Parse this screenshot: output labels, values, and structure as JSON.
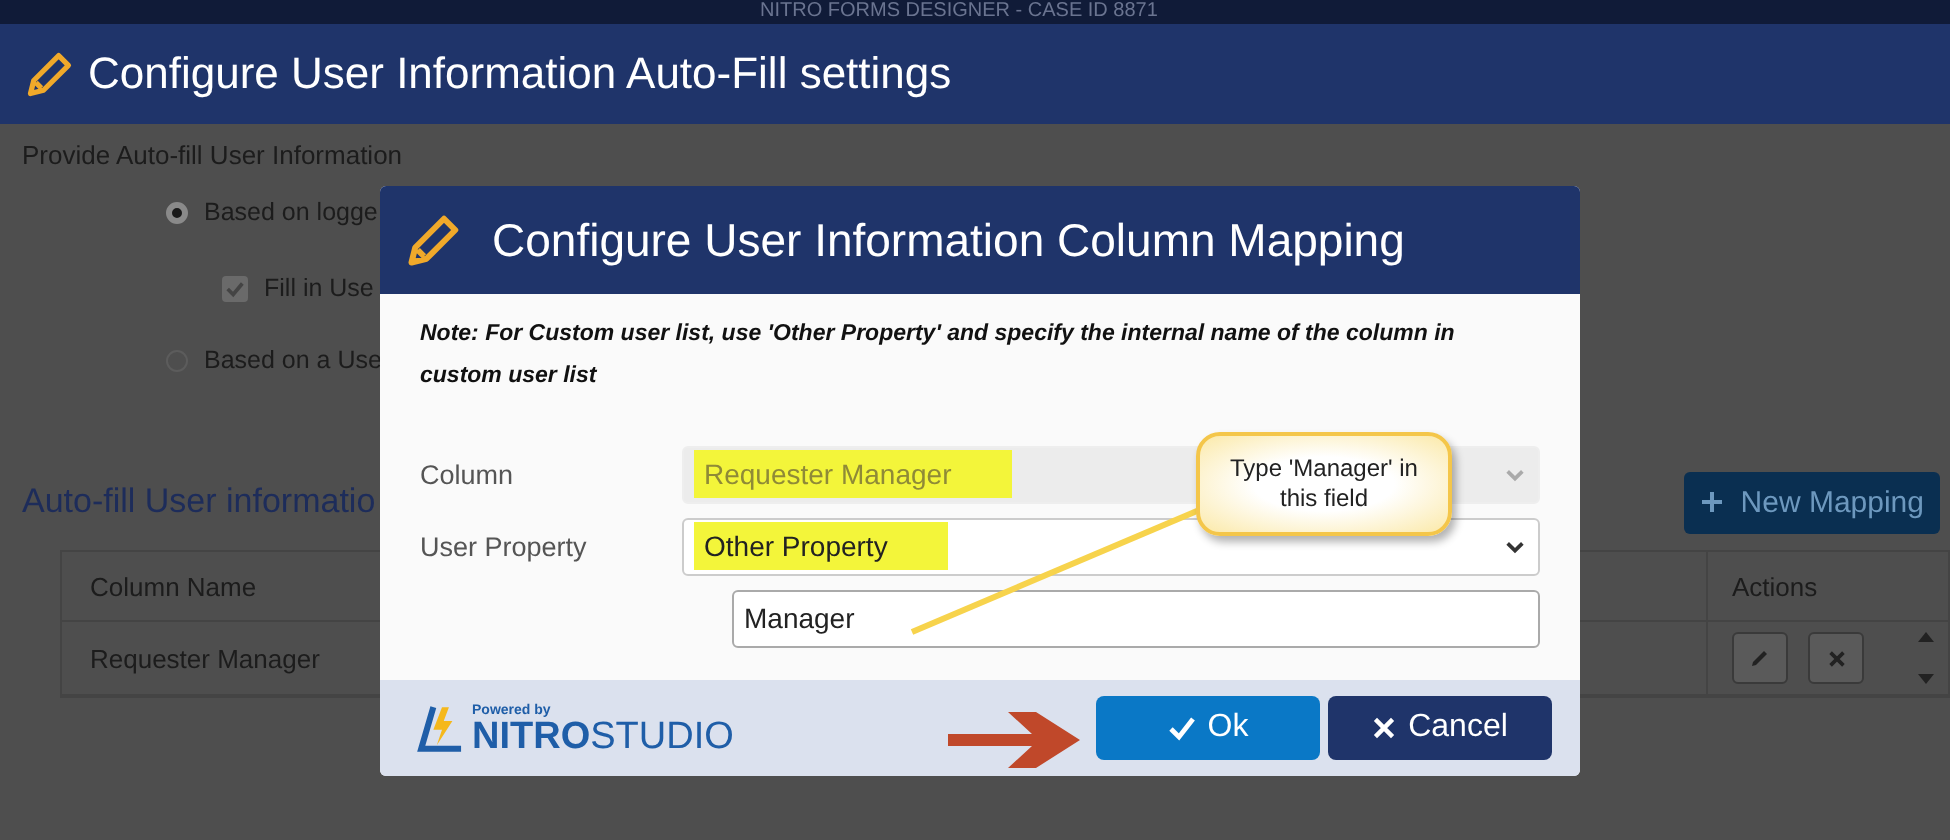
{
  "app_header": {
    "title": "NITRO FORMS DESIGNER - CASE ID 8871"
  },
  "page_header": {
    "title": "Configure User Information Auto-Fill settings"
  },
  "autofill_section": {
    "label": "Provide Auto-fill User Information",
    "options": [
      {
        "kind": "radio",
        "label": "Based on logge",
        "selected": true
      },
      {
        "kind": "checkbox",
        "label": "Fill in Use",
        "checked": true
      },
      {
        "kind": "radio",
        "label": "Based on a Use",
        "selected": false
      }
    ]
  },
  "mappings": {
    "title": "Auto-fill User informatio",
    "new_button": "New Mapping",
    "columns": [
      "Column Name",
      "Actions"
    ],
    "rows": [
      {
        "column_name": "Requester Manager"
      }
    ]
  },
  "dialog": {
    "title": "Configure User Information Column Mapping",
    "note": "Note: For Custom user list, use 'Other Property' and specify the internal name of the column in custom user list",
    "fields": [
      {
        "label": "Column",
        "value": "Requester Manager",
        "disabled": true,
        "highlighted": true
      },
      {
        "label": "User Property",
        "value": "Other Property",
        "disabled": false,
        "highlighted": true
      }
    ],
    "other_property_value": "Manager",
    "powered_by": "Powered by",
    "brand_bold": "NITRO",
    "brand_light": "STUDIO",
    "buttons": [
      {
        "kind": "primary",
        "label": "Ok"
      },
      {
        "kind": "secondary",
        "label": "Cancel"
      }
    ]
  },
  "callout": {
    "text": "Type 'Manager' in this field"
  }
}
